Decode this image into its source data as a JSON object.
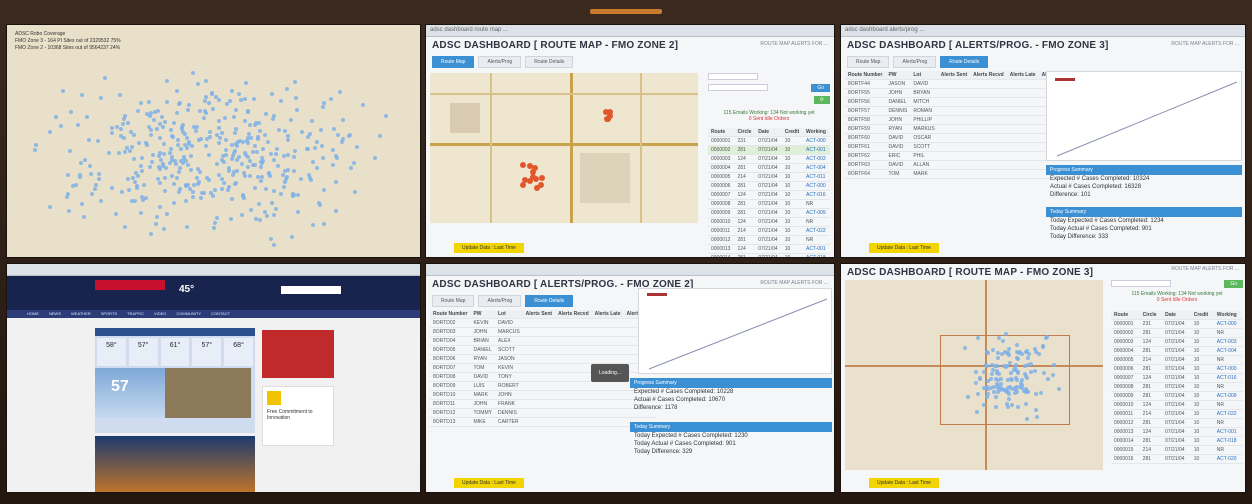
{
  "screens": {
    "map1": {
      "legend_lines": [
        "ADSC Robo Coverage",
        "FMO Zone 3 - 164 PI Sites out of 2329532 75%",
        "FMO Zone 2 - 10368 Sites out of 9564237 24%"
      ]
    },
    "route2": {
      "browser_bar": "adsc dashboard   route map   ...",
      "title": "ADSC DASHBOARD [ ROUTE MAP - FMO ZONE 2]",
      "top_links": "ROUTE MAP   ALERTS   FOR   ...",
      "tabs": [
        "Route Map",
        "Alerts/Prog",
        "Route Details"
      ],
      "active_tab": 0,
      "sidebar_go_label": "Go",
      "status_line1": "115 Emails Working: 134 Not working yet",
      "status_line2": "0 Sent Idle Orders",
      "table_header": [
        "Route",
        "Circle",
        "Date",
        "Credit",
        "Working"
      ],
      "table_rows": [
        [
          "0000001",
          "231",
          "07/21/04",
          "10",
          "ACT-000"
        ],
        [
          "0000002",
          "281",
          "07/21/04",
          "10",
          "ACT-001"
        ],
        [
          "0000003",
          "124",
          "07/21/04",
          "10",
          "ACT-003"
        ],
        [
          "0000004",
          "281",
          "07/21/04",
          "10",
          "ACT-004"
        ],
        [
          "0000005",
          "214",
          "07/21/04",
          "10",
          "ACT-011"
        ],
        [
          "0000006",
          "281",
          "07/21/04",
          "10",
          "ACT-000"
        ],
        [
          "0000007",
          "124",
          "07/21/04",
          "10",
          "ACT-016"
        ],
        [
          "0000008",
          "281",
          "07/21/04",
          "10",
          "NR"
        ],
        [
          "0000009",
          "281",
          "07/21/04",
          "10",
          "ACT-009"
        ],
        [
          "0000010",
          "124",
          "07/21/04",
          "10",
          "NR"
        ],
        [
          "0000011",
          "214",
          "07/21/04",
          "10",
          "ACT-022"
        ],
        [
          "0000012",
          "281",
          "07/21/04",
          "10",
          "NR"
        ],
        [
          "0000013",
          "124",
          "07/21/04",
          "10",
          "ACT-001"
        ],
        [
          "0000014",
          "281",
          "07/21/04",
          "10",
          "ACT-018"
        ]
      ],
      "footer_btn": "Update Data : Last Time"
    },
    "alerts3": {
      "browser_bar": "adsc dashboard   alerts/prog   ...",
      "title": "ADSC DASHBOARD [ ALERTS/PROG. - FMO ZONE 3]",
      "top_links": "ROUTE MAP   ALERTS   FOR   ...",
      "tabs": [
        "Route Map",
        "Alerts/Prog",
        "Route Details"
      ],
      "active_tab": 2,
      "table_header": [
        "Route Number",
        "PW",
        "Lot",
        "Alerts Sent",
        "Alerts Recvd",
        "Alerts Late",
        "Alerts Miss"
      ],
      "table_rows": [
        [
          "8ORTF44",
          "JASON",
          "DAVID"
        ],
        [
          "8ORTF55",
          "JOHN",
          "BRYAN"
        ],
        [
          "8ORTF56",
          "DANIEL",
          "MITCH"
        ],
        [
          "8ORTF57",
          "DENNIS",
          "ROMAN"
        ],
        [
          "8ORTF58",
          "JOHN",
          "PHILLIP"
        ],
        [
          "8ORTF59",
          "RYAN",
          "MARKUS"
        ],
        [
          "8ORTF60",
          "DAVID",
          "OSCAR"
        ],
        [
          "8ORTF61",
          "DAVID",
          "SCOTT"
        ],
        [
          "8ORTF62",
          "ERIC",
          "PHIL"
        ],
        [
          "8ORTF63",
          "DAVID",
          "ALLAN"
        ],
        [
          "8ORTF64",
          "TOM",
          "MARK"
        ]
      ],
      "progress_head": "Progress Summary",
      "progress_lines": [
        "Expected # Cases Completed: 10324",
        "Actual # Cases Completed: 16328",
        "Difference: 101"
      ],
      "today_head": "Today Summary",
      "today_lines": [
        "Today Expected # Cases Completed: 1234",
        "Today Actual # Cases Completed: 901",
        "Today Difference: 333"
      ],
      "footer_btn": "Update Data : Last Time"
    },
    "weather4": {
      "temp": "45°",
      "big_temp": "57",
      "forecast_temps": [
        "58°",
        "57°",
        "61°",
        "57°",
        "68°"
      ],
      "nav_items": [
        "HOME",
        "NEWS",
        "WEATHER",
        "SPORTS",
        "TRAFFIC",
        "VIDEO",
        "COMMUNITY",
        "CONTACT"
      ],
      "promo_title": "Free Commitment to Innovation"
    },
    "alerts5": {
      "title": "ADSC DASHBOARD [ ALERTS/PROG. - FMO ZONE 2]",
      "top_links": "ROUTE MAP   ALERTS   FOR   ...",
      "tabs": [
        "Route Map",
        "Alerts/Prog",
        "Route Details"
      ],
      "active_tab": 2,
      "table_header": [
        "Route Number",
        "PW",
        "Lot",
        "Alerts Sent",
        "Alerts Recvd",
        "Alerts Late",
        "Alerts Miss"
      ],
      "table_rows": [
        [
          "8ORTD02",
          "KEVIN",
          "DAVID"
        ],
        [
          "8ORTD03",
          "JOHN",
          "MARCUS"
        ],
        [
          "8ORTD04",
          "BRIAN",
          "ALEX"
        ],
        [
          "8ORTD05",
          "DANIEL",
          "SCOTT"
        ],
        [
          "8ORTD06",
          "RYAN",
          "JASON"
        ],
        [
          "8ORTD07",
          "TOM",
          "KEVIN"
        ],
        [
          "8ORTD08",
          "DAVID",
          "TONY"
        ],
        [
          "8ORTD09",
          "LUIS",
          "ROBERT"
        ],
        [
          "8ORTD10",
          "MARK",
          "JOHN"
        ],
        [
          "8ORTD11",
          "JOHN",
          "FRANK"
        ],
        [
          "8ORTD12",
          "TOMMY",
          "DENNIS"
        ],
        [
          "8ORTD13",
          "MIKE",
          "CARTER"
        ]
      ],
      "tooltip": "Loading...",
      "progress_head": "Progress Summary",
      "progress_lines": [
        "Expected # Cases Completed: 10228",
        "Actual # Cases Completed: 10670",
        "Difference: 1178"
      ],
      "today_head": "Today Summary",
      "today_lines": [
        "Today Expected # Cases Completed: 1230",
        "Today Actual # Cases Completed: 901",
        "Today Difference: 329"
      ],
      "footer_btn": "Update Data : Last Time"
    },
    "route6": {
      "title": "ADSC DASHBOARD [ ROUTE MAP - FMO ZONE 3]",
      "top_links": "ROUTE MAP   ALERTS   FOR   ...",
      "go_label": "Go",
      "status_line1": "115 Emails Working: 134 Not working yet",
      "status_line2": "0 Sent Idle Orders",
      "table_header": [
        "Route",
        "Circle",
        "Date",
        "Credit",
        "Working"
      ],
      "table_rows": [
        [
          "0000001",
          "231",
          "07/21/04",
          "10",
          "ACT-000"
        ],
        [
          "0000002",
          "281",
          "07/21/04",
          "10",
          "NR"
        ],
        [
          "0000003",
          "124",
          "07/21/04",
          "10",
          "ACT-003"
        ],
        [
          "0000004",
          "281",
          "07/21/04",
          "10",
          "ACT-004"
        ],
        [
          "0000005",
          "214",
          "07/21/04",
          "10",
          "NR"
        ],
        [
          "0000006",
          "281",
          "07/21/04",
          "10",
          "ACT-000"
        ],
        [
          "0000007",
          "124",
          "07/21/04",
          "10",
          "ACT-016"
        ],
        [
          "0000008",
          "281",
          "07/21/04",
          "10",
          "NR"
        ],
        [
          "0000009",
          "281",
          "07/21/04",
          "10",
          "ACT-009"
        ],
        [
          "0000010",
          "124",
          "07/21/04",
          "10",
          "NR"
        ],
        [
          "0000011",
          "214",
          "07/21/04",
          "10",
          "ACT-022"
        ],
        [
          "0000012",
          "281",
          "07/21/04",
          "10",
          "NR"
        ],
        [
          "0000013",
          "124",
          "07/21/04",
          "10",
          "ACT-001"
        ],
        [
          "0000014",
          "281",
          "07/21/04",
          "10",
          "ACT-018"
        ],
        [
          "0000015",
          "214",
          "07/21/04",
          "10",
          "NR"
        ],
        [
          "0000016",
          "281",
          "07/21/04",
          "10",
          "ACT-020"
        ]
      ],
      "footer_btn": "Update Data : Last Time"
    }
  },
  "colors": {
    "accent": "#3b8fd3",
    "yellow": "#f1d400",
    "map_dots": "#7fb0e8",
    "route_dots": "#e1572b"
  }
}
